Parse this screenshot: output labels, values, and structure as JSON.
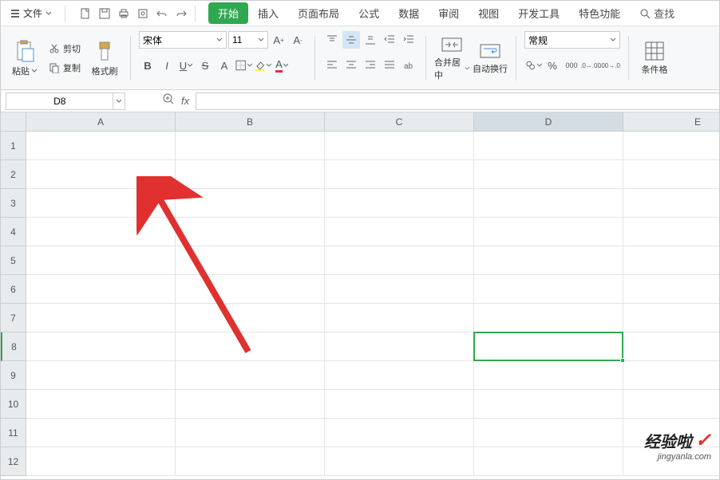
{
  "menu": {
    "file": "文件"
  },
  "tabs": {
    "start": "开始",
    "insert": "插入",
    "layout": "页面布局",
    "formula": "公式",
    "data": "数据",
    "review": "审阅",
    "view": "视图",
    "dev": "开发工具",
    "special": "特色功能",
    "search": "查找"
  },
  "ribbon": {
    "paste": "粘贴",
    "cut": "剪切",
    "copy": "复制",
    "format_painter": "格式刷",
    "font_name": "宋体",
    "font_size": "11",
    "merge": "合并居中",
    "wrap": "自动换行",
    "number_format": "常规",
    "cond_format": "条件格"
  },
  "namebox": {
    "cell_ref": "D8"
  },
  "columns": [
    "A",
    "B",
    "C",
    "D",
    "E"
  ],
  "rows": [
    "1",
    "2",
    "3",
    "4",
    "5",
    "6",
    "7",
    "8",
    "9",
    "10",
    "11",
    "12"
  ],
  "selected": {
    "col": "D",
    "row": "8"
  },
  "watermark": {
    "main": "经验啦",
    "sub": "jingyanla.com"
  }
}
